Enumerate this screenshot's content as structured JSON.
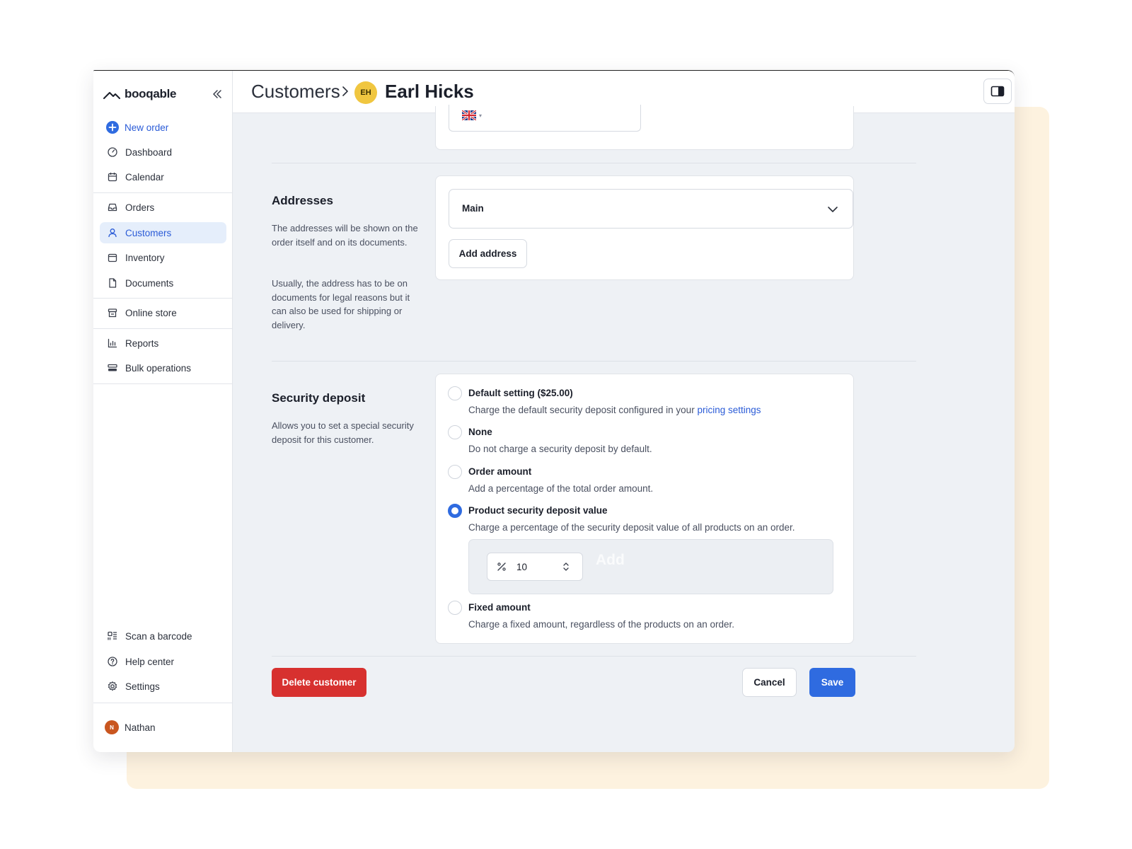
{
  "app": {
    "brand": "booqable"
  },
  "sidebar": {
    "new_order": "New order",
    "items": [
      {
        "label": "Dashboard",
        "icon": "dashboard-icon"
      },
      {
        "label": "Calendar",
        "icon": "calendar-icon"
      },
      {
        "label": "Orders",
        "icon": "inbox-icon"
      },
      {
        "label": "Customers",
        "icon": "user-icon",
        "active": true
      },
      {
        "label": "Inventory",
        "icon": "box-icon"
      },
      {
        "label": "Documents",
        "icon": "document-icon"
      },
      {
        "label": "Online store",
        "icon": "store-icon"
      },
      {
        "label": "Reports",
        "icon": "bar-chart-icon"
      },
      {
        "label": "Bulk operations",
        "icon": "layers-icon"
      }
    ],
    "bottom_items": [
      {
        "label": "Scan a barcode",
        "icon": "barcode-icon"
      },
      {
        "label": "Help center",
        "icon": "help-icon"
      },
      {
        "label": "Settings",
        "icon": "gear-icon"
      }
    ],
    "user": {
      "initial": "N",
      "name": "Nathan"
    }
  },
  "header": {
    "breadcrumb": "Customers",
    "avatar_initials": "EH",
    "customer_name": "Earl Hicks"
  },
  "addresses": {
    "title": "Addresses",
    "desc1": "The addresses will be shown on the order itself and on its documents.",
    "desc2": "Usually, the address has to be on documents for legal reasons but it can also be used for shipping or delivery.",
    "selected": "Main",
    "add_button": "Add address"
  },
  "security_deposit": {
    "title": "Security deposit",
    "desc": "Allows you to set a special security deposit for this customer.",
    "options": [
      {
        "title": "Default setting ($25.00)",
        "desc": "Charge the default security deposit configured in your ",
        "link": "pricing settings",
        "checked": false
      },
      {
        "title": "None",
        "desc": "Do not charge a security deposit by default.",
        "checked": false
      },
      {
        "title": "Order amount",
        "desc": "Add a percentage of the total order amount.",
        "checked": false
      },
      {
        "title": "Product security deposit value",
        "desc": "Charge a percentage of the security deposit value of all products on an order.",
        "checked": true
      },
      {
        "title": "Fixed amount",
        "desc": "Charge a fixed amount, regardless of the products on an order.",
        "checked": false
      }
    ],
    "percentage_value": "10",
    "ghost_add": "Add"
  },
  "footer": {
    "delete": "Delete customer",
    "cancel": "Cancel",
    "save": "Save"
  },
  "colors": {
    "primary": "#2f6be0",
    "danger": "#d7312f",
    "avatar": "#f0c640",
    "user_avatar": "#c9561f",
    "backdrop": "#fdf2df"
  }
}
